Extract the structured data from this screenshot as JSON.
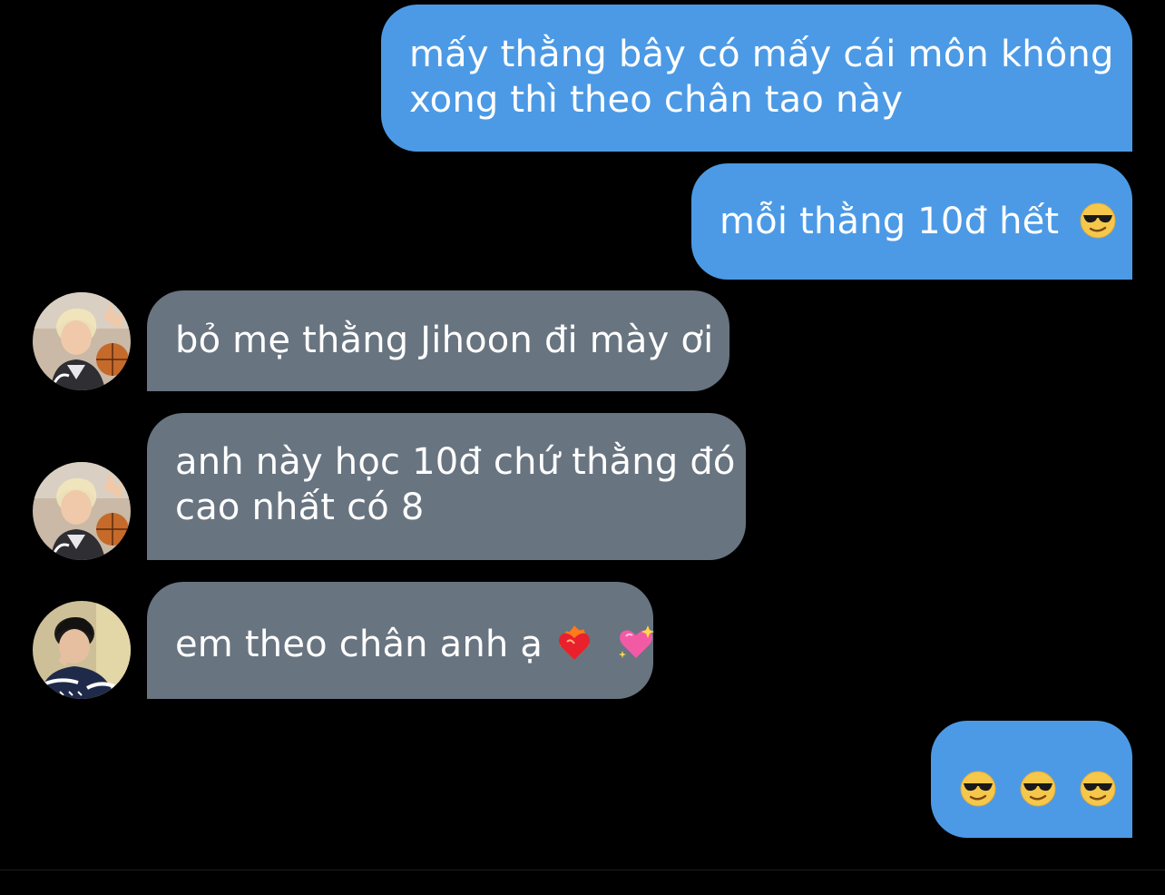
{
  "messages": [
    {
      "sender": "me",
      "lines": [
        "mấy thằng bây có mấy cái môn không",
        "xong thì theo chân tao này"
      ]
    },
    {
      "sender": "me",
      "text": "mỗi thằng 10đ hết",
      "emoji": "sunglasses-emoji"
    },
    {
      "sender": "them",
      "avatar": "avatar-blond-basketball",
      "text": "bỏ mẹ thằng Jihoon đi mày ơi"
    },
    {
      "sender": "them",
      "avatar": "avatar-blond-basketball",
      "lines": [
        "anh này học 10đ chứ thằng đó",
        "cao nhất có 8"
      ]
    },
    {
      "sender": "them",
      "avatar": "avatar-dark-hair-jacket",
      "text": "em theo chân anh ạ",
      "emojis": [
        "heart-on-fire-emoji",
        "sparkling-heart-emoji"
      ]
    },
    {
      "sender": "me",
      "emojis": [
        "sunglasses-emoji",
        "sunglasses-emoji",
        "sunglasses-emoji"
      ]
    }
  ],
  "colors": {
    "background": "#000000",
    "outgoing_bubble": "#4c9ae6",
    "incoming_bubble": "#687480",
    "text": "#ffffff"
  }
}
